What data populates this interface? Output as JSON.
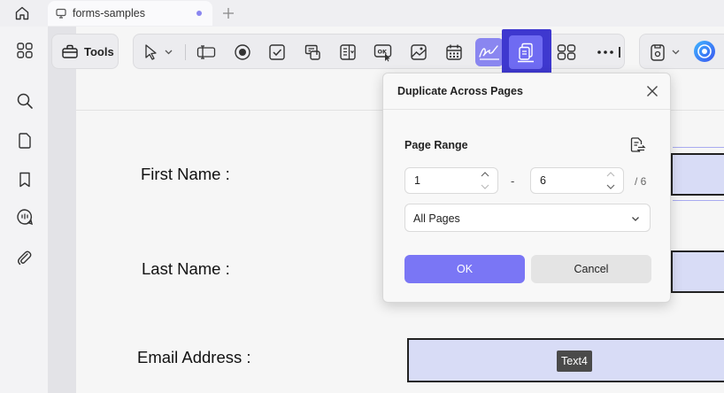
{
  "colors": {
    "accent": "#7a76f5",
    "highlight": "#3e38cf",
    "field_fill": "#d8dcf6"
  },
  "tabbar": {
    "home_icon": "home-icon",
    "tab": {
      "label": "forms-samples",
      "icon": "document-icon",
      "modified_dot": true
    },
    "new_tab_icon": "plus-icon"
  },
  "sidebar": {
    "items": [
      {
        "icon": "thumbnails-icon"
      },
      {
        "icon": "search-icon"
      },
      {
        "icon": "page-icon"
      },
      {
        "icon": "bookmark-icon"
      },
      {
        "icon": "comment-icon"
      },
      {
        "icon": "attachment-icon"
      }
    ]
  },
  "toolbar": {
    "tools_label": "Tools",
    "tools": [
      "select-arrow-icon",
      "text-field-icon",
      "radio-button-icon",
      "checkbox-icon",
      "list-box-icon",
      "dropdown-icon",
      "button-ok-icon",
      "image-icon",
      "date-icon",
      "signature-icon",
      "duplicate-pages-icon",
      "grid-icon",
      "more-icon"
    ]
  },
  "form": {
    "fields": [
      {
        "label": "First Name :"
      },
      {
        "label": "Last Name :"
      },
      {
        "label": "Email Address :",
        "tooltip": "Text4"
      }
    ]
  },
  "dialog": {
    "title": "Duplicate Across Pages",
    "page_range_label": "Page Range",
    "from_value": "1",
    "to_value": "6",
    "dash": "-",
    "total": "/ 6",
    "range_option": "All Pages",
    "ok_label": "OK",
    "cancel_label": "Cancel"
  }
}
